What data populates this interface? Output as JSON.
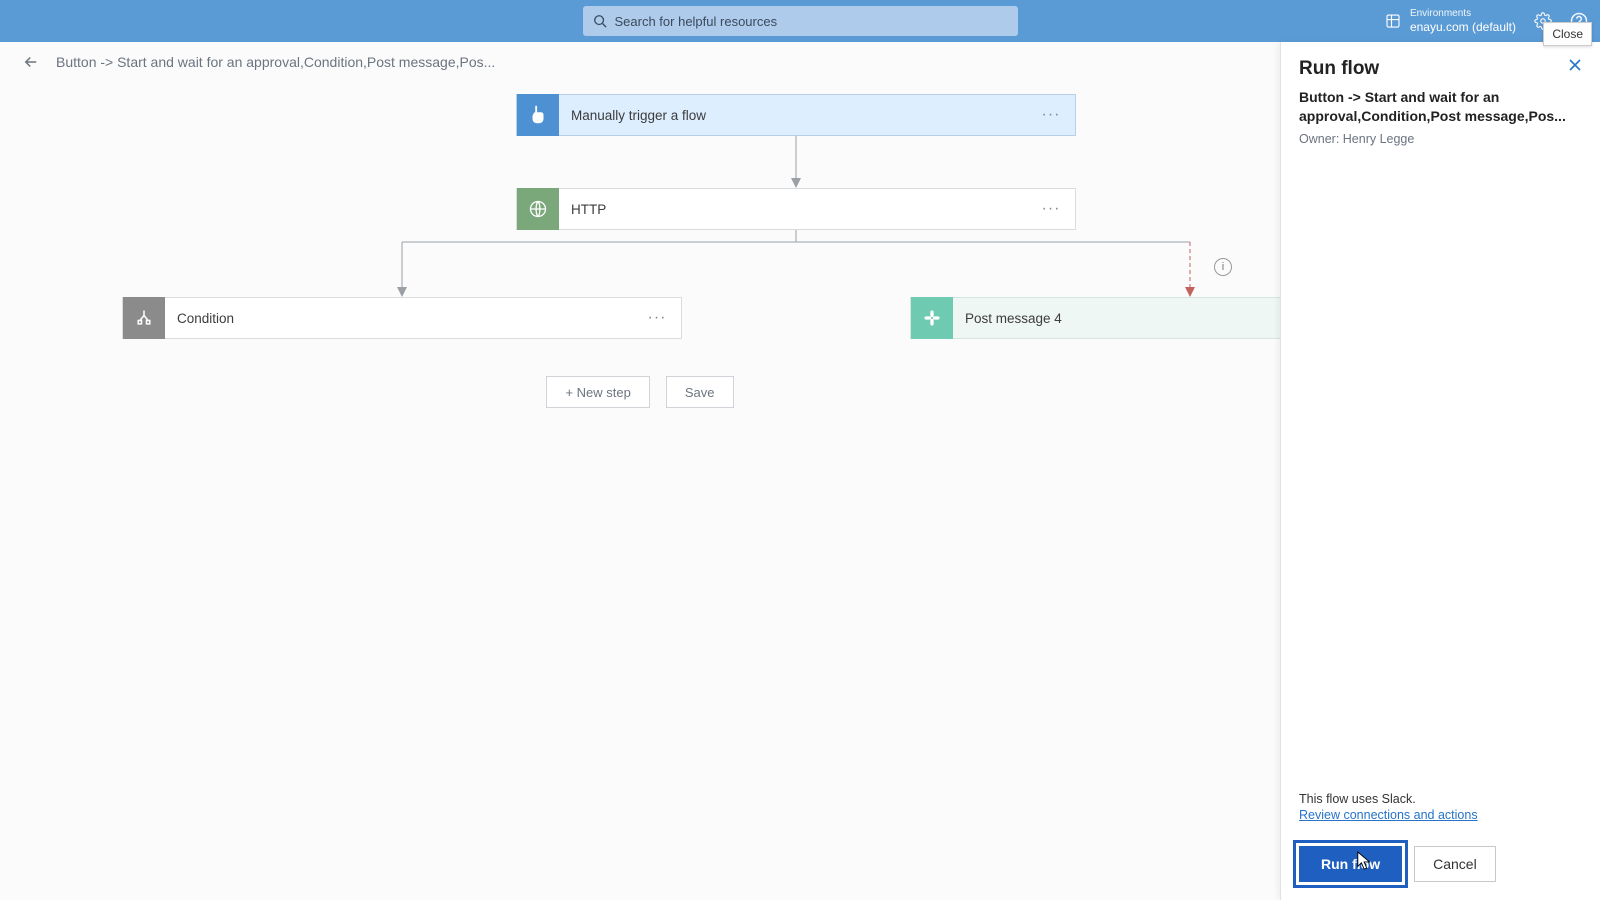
{
  "search": {
    "placeholder": "Search for helpful resources"
  },
  "env": {
    "label": "Environments",
    "name": "enayu.com (default)"
  },
  "tooltip": {
    "close": "Close"
  },
  "breadcrumb": "Button -> Start and wait for an approval,Condition,Post message,Pos...",
  "cards": {
    "trigger": "Manually trigger a flow",
    "http": "HTTP",
    "condition": "Condition",
    "postmsg": "Post message 4"
  },
  "buttons": {
    "newstep": "+ New step",
    "save": "Save"
  },
  "panel": {
    "title": "Run flow",
    "subtitle": "Button -> Start and wait for an approval,Condition,Post message,Pos...",
    "owner": "Owner: Henry Legge",
    "note": "This flow uses Slack.",
    "link": "Review connections and actions",
    "run": "Run flow",
    "cancel": "Cancel"
  }
}
